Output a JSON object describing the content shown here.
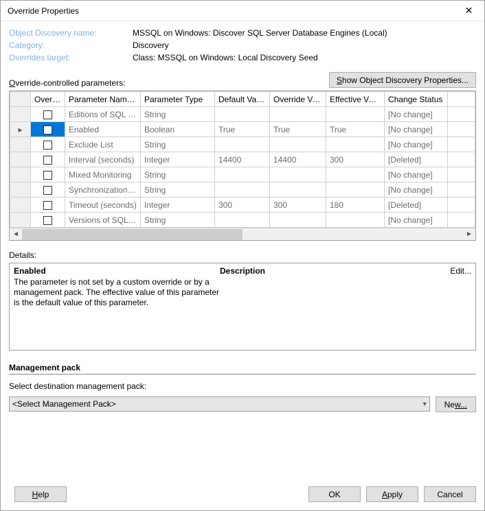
{
  "titlebar": {
    "title": "Override Properties"
  },
  "info": {
    "label_discovery": "Object Discovery name:",
    "value_discovery": "MSSQL on Windows: Discover SQL Server Database Engines (Local)",
    "label_category": "Category:",
    "value_category": "Discovery",
    "label_target": "Overrides target:",
    "value_target": "Class: MSSQL on Windows: Local Discovery Seed"
  },
  "paramsLabel": "Override-controlled parameters:",
  "showPropsPrefix": "S",
  "showPropsRest": "how Object Discovery Properties...",
  "columns": {
    "override": "Override",
    "pname": "Parameter Name",
    "ptype": "Parameter Type",
    "defv": "Default Value",
    "ovrv": "Override Value",
    "effv": "Effective Value",
    "chg": "Change Status"
  },
  "rows": [
    {
      "sel": false,
      "name": "Editions of SQL Ser...",
      "type": "String",
      "dv": "",
      "ov": "",
      "ev": "",
      "cs": "[No change]"
    },
    {
      "sel": true,
      "name": "Enabled",
      "type": "Boolean",
      "dv": "True",
      "ov": "True",
      "ev": "True",
      "cs": "[No change]"
    },
    {
      "sel": false,
      "name": "Exclude List",
      "type": "String",
      "dv": "",
      "ov": "",
      "ev": "",
      "cs": "[No change]"
    },
    {
      "sel": false,
      "name": "Interval (seconds)",
      "type": "Integer",
      "dv": "14400",
      "ov": "14400",
      "ev": "300",
      "cs": "[Deleted]"
    },
    {
      "sel": false,
      "name": "Mixed Monitoring",
      "type": "String",
      "dv": "",
      "ov": "",
      "ev": "",
      "cs": "[No change]"
    },
    {
      "sel": false,
      "name": "Synchronization Time",
      "type": "String",
      "dv": "",
      "ov": "",
      "ev": "",
      "cs": "[No change]"
    },
    {
      "sel": false,
      "name": "Timeout (seconds)",
      "type": "Integer",
      "dv": "300",
      "ov": "300",
      "ev": "180",
      "cs": "[Deleted]"
    },
    {
      "sel": false,
      "name": "Versions of SQL Se...",
      "type": "String",
      "dv": "",
      "ov": "",
      "ev": "",
      "cs": "[No change]"
    }
  ],
  "detailsLabel": "Details:",
  "details": {
    "title": "Enabled",
    "descLabel": "Description",
    "editLabel": "Edit...",
    "text": "The parameter is not set by a custom override or by a management pack. The effective value of this parameter is the default value of this parameter."
  },
  "mp": {
    "heading": "Management pack",
    "selectLabel": "Select destination management pack:",
    "selectValue": "<Select Management Pack>",
    "newPrefix": "Ne",
    "newRest": "w..."
  },
  "footer": {
    "help": "Help",
    "ok": "OK",
    "apply": "Apply",
    "cancel": "Cancel"
  }
}
